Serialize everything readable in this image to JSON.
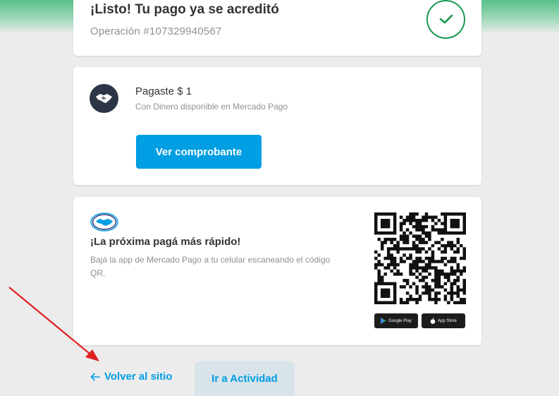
{
  "status": {
    "title": "¡Listo! Tu pago ya se acreditó",
    "operation": "Operación #107329940567",
    "icon": "check-icon",
    "color": "#1a9a52"
  },
  "payment": {
    "title": "Pagaste $ 1",
    "subtitle": "Con Dinero disponible en Mercado Pago",
    "button_label": "Ver comprobante",
    "icon": "handshake-icon"
  },
  "app_promo": {
    "title": "¡La próxima pagá más rápido!",
    "description": "Bajá la app de Mercado Pago a tu celular escaneando el código QR.",
    "google_play_label": "Google Play",
    "app_store_label": "App Store"
  },
  "footer": {
    "back_label": "Volver al sitio",
    "activity_label": "Ir a Actividad"
  },
  "colors": {
    "accent": "#009ee3",
    "success": "#1a9a52",
    "annotation": "#e02020"
  }
}
